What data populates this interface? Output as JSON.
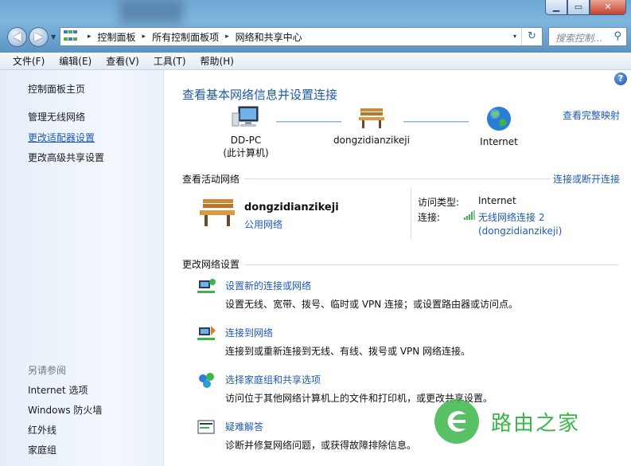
{
  "window": {
    "minimize": "▁",
    "maximize": "▭",
    "close": "✕"
  },
  "nav": {
    "back": "◀",
    "forward": "▶",
    "dropdown": "▼"
  },
  "address": {
    "crumbs": [
      "控制面板",
      "所有控制面板项",
      "网络和共享中心"
    ],
    "separator": "▸",
    "refresh": "↻",
    "dropdown": "▾"
  },
  "search": {
    "placeholder": "搜索控制...",
    "icon": "search-icon"
  },
  "menu": [
    "文件(F)",
    "编辑(E)",
    "查看(V)",
    "工具(T)",
    "帮助(H)"
  ],
  "sidebar": {
    "items": [
      "控制面板主页",
      "管理无线网络",
      "更改适配器设置",
      "更改高级共享设置"
    ],
    "see_also_heading": "另请参阅",
    "see_also": [
      "Internet 选项",
      "Windows 防火墙",
      "红外线",
      "家庭组"
    ]
  },
  "main": {
    "help": "?",
    "title": "查看基本网络信息并设置连接",
    "full_map": "查看完整映射",
    "map": {
      "pc_name": "DD-PC",
      "pc_sub": "(此计算机)",
      "network": "dongzidianzikeji",
      "internet": "Internet"
    },
    "active": {
      "heading": "查看活动网络",
      "connect_link": "连接或断开连接",
      "network_name": "dongzidianzikeji",
      "network_type": "公用网络",
      "access_label": "访问类型:",
      "access_value": "Internet",
      "conn_label": "连接:",
      "conn_value_line1": "无线网络连接 2",
      "conn_value_line2": "(dongzidianzikeji)"
    },
    "change": {
      "heading": "更改网络设置",
      "tasks": [
        {
          "title": "设置新的连接或网络",
          "desc": "设置无线、宽带、拨号、临时或 VPN 连接；或设置路由器或访问点。"
        },
        {
          "title": "连接到网络",
          "desc": "连接到或重新连接到无线、有线、拨号或 VPN 网络连接。"
        },
        {
          "title": "选择家庭组和共享选项",
          "desc": "访问位于其他网络计算机上的文件和打印机，或更改共享设置。"
        },
        {
          "title": "疑难解答",
          "desc": "诊断并修复网络问题，或获得故障排除信息。"
        }
      ]
    }
  },
  "watermark": {
    "text": "路由之家"
  },
  "colors": {
    "link": "#1f5ab8",
    "title": "#1d5aa8",
    "accent_green": "#3db54a"
  }
}
